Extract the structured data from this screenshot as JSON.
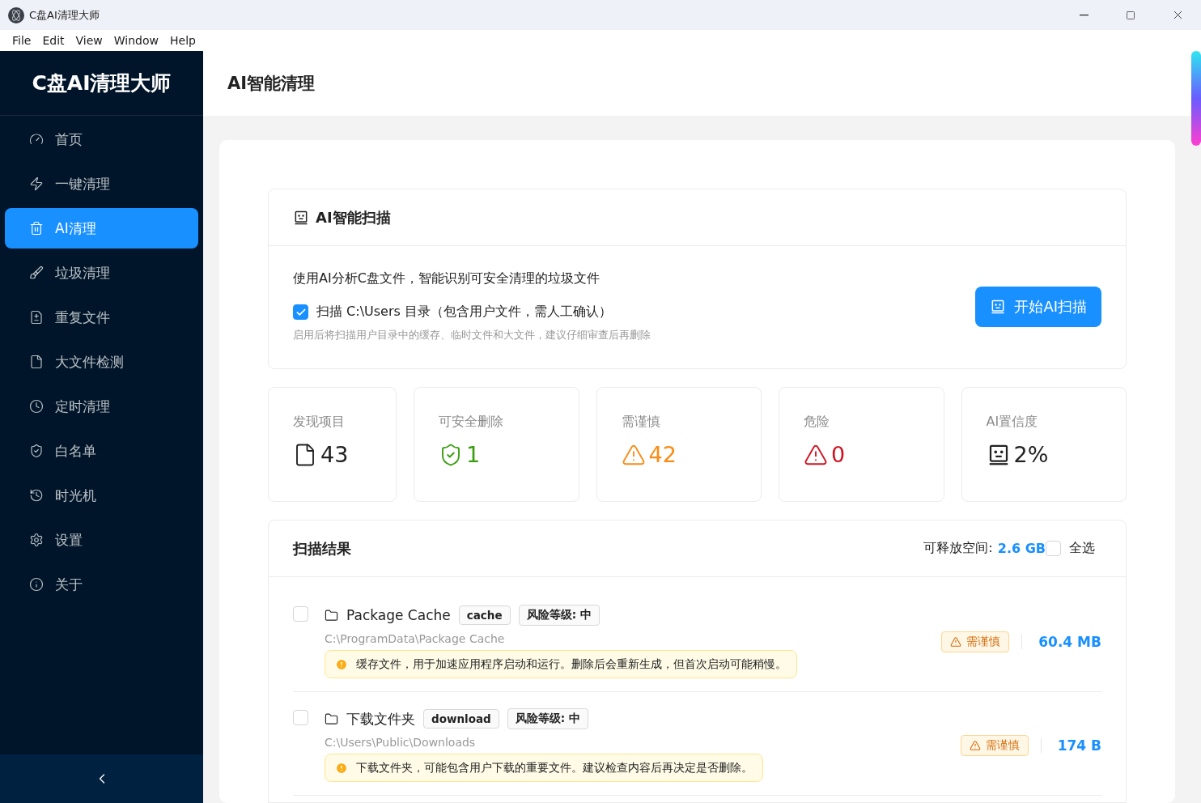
{
  "window": {
    "title": "C盘AI清理大师"
  },
  "menu": [
    "File",
    "Edit",
    "View",
    "Window",
    "Help"
  ],
  "sidebar": {
    "logo": "C盘AI清理大师",
    "items": [
      {
        "kind": "home",
        "label": "首页",
        "selected": false
      },
      {
        "kind": "quick",
        "label": "一键清理",
        "selected": false
      },
      {
        "kind": "ai",
        "label": "AI清理",
        "selected": true
      },
      {
        "kind": "junk",
        "label": "垃圾清理",
        "selected": false
      },
      {
        "kind": "duplicate",
        "label": "重复文件",
        "selected": false
      },
      {
        "kind": "large",
        "label": "大文件检测",
        "selected": false
      },
      {
        "kind": "schedule",
        "label": "定时清理",
        "selected": false
      },
      {
        "kind": "whitelist",
        "label": "白名单",
        "selected": false
      },
      {
        "kind": "timemachine",
        "label": "时光机",
        "selected": false
      },
      {
        "kind": "settings",
        "label": "设置",
        "selected": false
      },
      {
        "kind": "about",
        "label": "关于",
        "selected": false
      }
    ]
  },
  "page_title": "AI智能清理",
  "scan_panel": {
    "title": "AI智能扫描",
    "description": "使用AI分析C盘文件，智能识别可安全清理的垃圾文件",
    "option": {
      "label": "扫描 C:\\Users 目录（包含用户文件，需人工确认）",
      "checked": true
    },
    "hint": "启用后将扫描用户目录中的缓存、临时文件和大文件，建议仔细审查后再删除",
    "button": "开始AI扫描"
  },
  "stats": [
    {
      "kind": "found",
      "label": "发现项目",
      "value": "43"
    },
    {
      "kind": "safe",
      "label": "可安全删除",
      "value": "1"
    },
    {
      "kind": "caution",
      "label": "需谨慎",
      "value": "42"
    },
    {
      "kind": "danger",
      "label": "危险",
      "value": "0"
    },
    {
      "kind": "confidence",
      "label": "AI置信度",
      "value": "2%"
    }
  ],
  "results": {
    "title": "扫描结果",
    "free_space_label": "可释放空间:",
    "free_space": "2.6 GB",
    "select_all": {
      "label": "全选",
      "checked": false
    },
    "items": [
      {
        "name": "Package Cache",
        "tag": "cache",
        "risk": "风险等级: 中",
        "path": "C:\\ProgramData\\Package Cache",
        "note": "缓存文件，用于加速应用程序启动和运行。删除后会重新生成，但首次启动可能稍慢。",
        "status": "需谨慎",
        "size": "60.4 MB",
        "checked": false
      },
      {
        "name": "下载文件夹",
        "tag": "download",
        "risk": "风险等级: 中",
        "path": "C:\\Users\\Public\\Downloads",
        "note": "下载文件夹，可能包含用户下载的重要文件。建议检查内容后再决定是否删除。",
        "status": "需谨慎",
        "size": "174 B",
        "checked": false
      }
    ]
  }
}
